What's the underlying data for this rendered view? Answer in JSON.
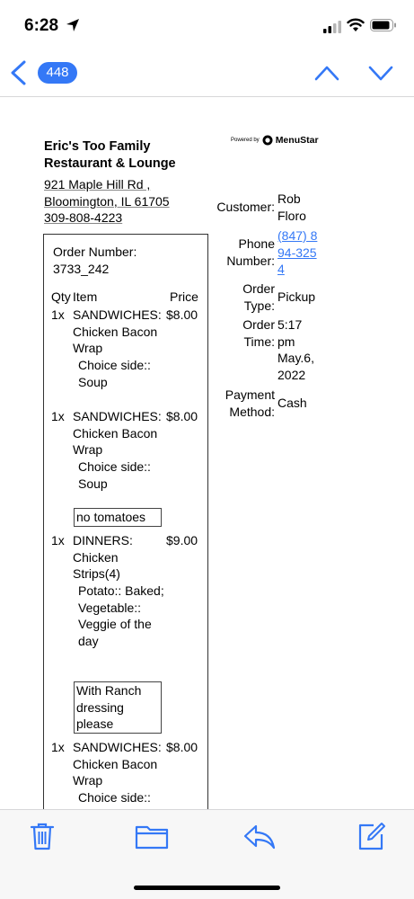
{
  "status_bar": {
    "time": "6:28",
    "icons": [
      "location-arrow-icon",
      "signal-icon",
      "wifi-icon",
      "battery-icon"
    ]
  },
  "nav": {
    "back_icon": "chevron-left-icon",
    "unread_count": "448",
    "prev_icon": "chevron-up-icon",
    "next_icon": "chevron-down-icon"
  },
  "email": {
    "restaurant_name": "Eric's Too Family Restaurant & Lounge",
    "powered_by": "Powered by",
    "brand": "MenuStar",
    "address_line1": "921 Maple Hill Rd ,",
    "address_line2": "Bloomington, IL 61705",
    "phone": "309-808-4223",
    "order": {
      "number_label": "Order Number:",
      "number": "3733_242",
      "headers": {
        "qty": "Qty",
        "item": "Item",
        "price": "Price"
      },
      "items": [
        {
          "qty": "1x",
          "name": "SANDWICHES: Chicken Bacon Wrap",
          "options": "Choice side:: Soup",
          "price": "$8.00"
        },
        {
          "qty": "1x",
          "name": "SANDWICHES: Chicken Bacon Wrap",
          "options": "Choice side:: Soup",
          "note": "no tomatoes",
          "price": "$8.00"
        },
        {
          "qty": "1x",
          "name": "DINNERS: Chicken Strips(4)",
          "options": "Potato:: Baked; Vegetable:: Veggie of the day",
          "note": "With Ranch dressing please",
          "price": "$9.00"
        },
        {
          "qty": "1x",
          "name": "SANDWICHES: Chicken Bacon Wrap",
          "options": "Choice side::",
          "price": "$8.00"
        }
      ]
    },
    "customer": {
      "customer_label": "Customer:",
      "customer": "Rob Floro",
      "phone_label": "Phone Number:",
      "phone": "(847) 894-3254",
      "order_type_label": "Order Type:",
      "order_type": "Pickup",
      "order_time_label": "Order Time:",
      "order_time": "5:17 pm May.6, 2022",
      "payment_label": "Payment Method:",
      "payment": "Cash"
    }
  },
  "toolbar": {
    "icons": [
      "trash-icon",
      "folder-icon",
      "reply-icon",
      "compose-icon"
    ]
  },
  "colors": {
    "accent": "#3478f6",
    "toolbar_bg": "#f7f7f7"
  }
}
